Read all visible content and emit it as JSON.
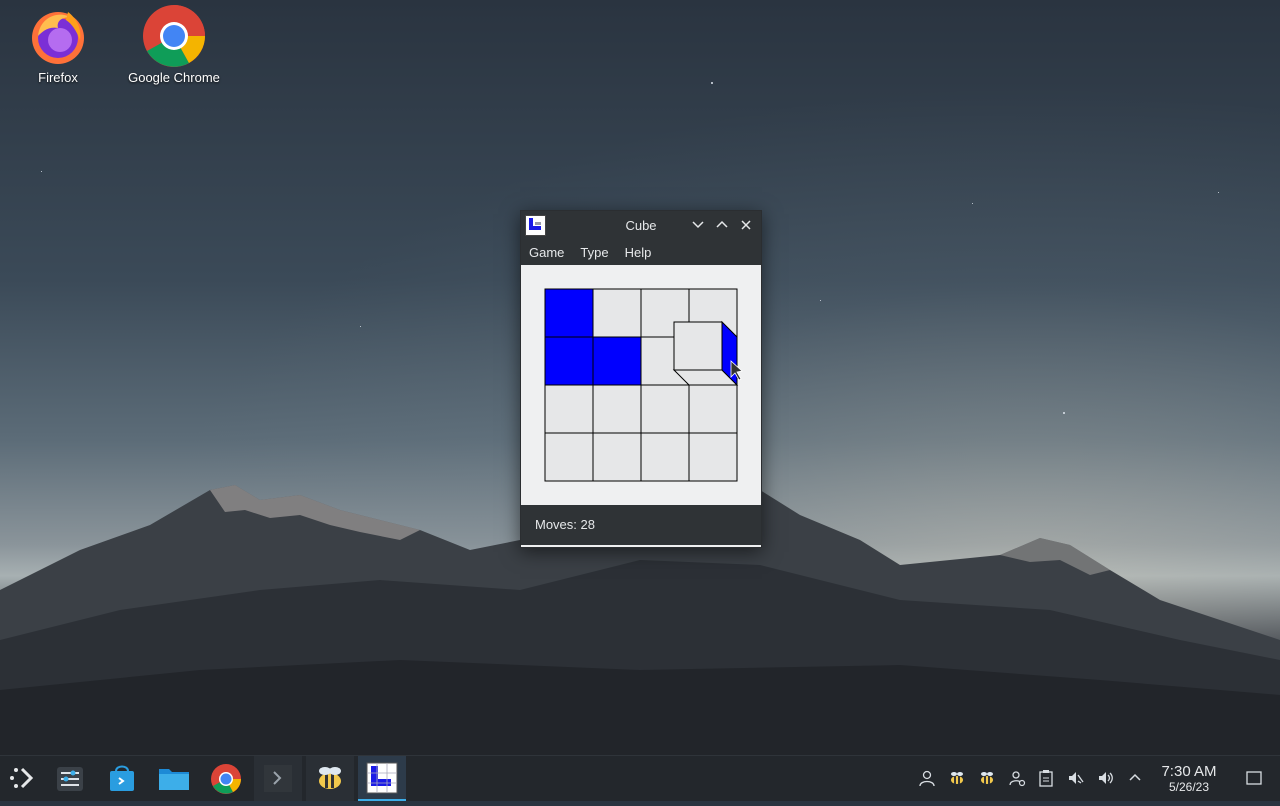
{
  "desktop": {
    "icons": [
      {
        "label": "Firefox"
      },
      {
        "label": "Google Chrome"
      }
    ]
  },
  "window": {
    "title": "Cube",
    "menu": [
      "Game",
      "Type",
      "Help"
    ],
    "status": "Moves: 28",
    "board": {
      "rows": 4,
      "cols": 4,
      "blue_cells": [
        [
          0,
          0
        ],
        [
          1,
          0
        ],
        [
          1,
          1
        ]
      ],
      "cube_position": [
        1,
        3
      ],
      "accent_color": "#0000ff"
    }
  },
  "taskbar": {
    "clock_time": "7:30 AM",
    "clock_date": "5/26/23",
    "accent": "#3daee9"
  }
}
